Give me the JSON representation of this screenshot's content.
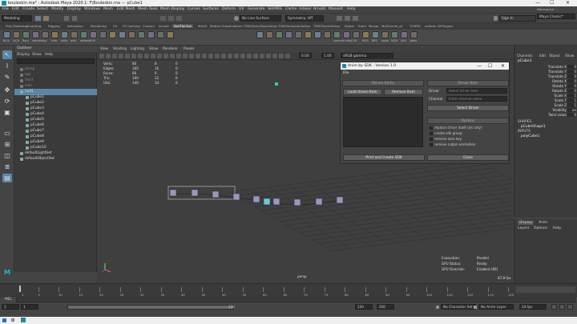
{
  "window": {
    "title": "bouleskin.ma* - Autodesk Maya 2020.1: F\\Bouleskin.ma  ---  pCube1",
    "min": "—",
    "max": "☐",
    "close": "✕"
  },
  "menubar": [
    "File",
    "Edit",
    "Create",
    "Select",
    "Modify",
    "Display",
    "Windows",
    "Mesh",
    "Edit Mesh",
    "Mesh Tools",
    "Mesh Display",
    "Curves",
    "Surfaces",
    "Deform",
    "UV",
    "Generate",
    "SHAPES",
    "Cache",
    "mGear",
    "Arnold",
    "MooseX",
    "Help"
  ],
  "statusline": {
    "mode": "Modeling",
    "live": "No Live Surface",
    "symmetry": "Symmetry: Off",
    "signin": "Sign In",
    "workspace_label": "Workspace :",
    "workspace": "Maya Classic*"
  },
  "shelf_tabs": [
    "Poly Modeling",
    "Sculpting",
    "Rigging",
    "Animation",
    "Rendering",
    "FX",
    "FX Caching",
    "Custom",
    "Arnold",
    "BatRTarTool",
    "MASH",
    "Motion Graphics",
    "XGen",
    "TSM2ExtraToolsSetup",
    "TSM2SelectionSetup",
    "TSM2FacialSetup",
    "Mgear",
    "Extra",
    "Mocap",
    "MuFtsirvie_vil",
    "TORTIE",
    "calbres",
    "GEPluginz"
  ],
  "shelf_labels": [
    "BrCh",
    "LtCh",
    "RsLn",
    "rebuild",
    "dup",
    "hide",
    "jntify",
    "wfrk",
    "rgReset",
    "CrM",
    "",
    "",
    "",
    "",
    "",
    "",
    "",
    "",
    "",
    "",
    "",
    "",
    "",
    "",
    "",
    "",
    "Lemma",
    "CrrMaj",
    "CM",
    "MCR",
    "BRS",
    "dublk",
    "MCM",
    "ARO",
    "bake"
  ],
  "outliner": {
    "title": "Outliner",
    "menu": [
      "Display",
      "Show",
      "Help"
    ],
    "items": [
      "persp",
      "top",
      "front",
      "side",
      "null1",
      "pCube1",
      "pCube2",
      "pCube3",
      "pCube4",
      "pCube5",
      "pCube6",
      "pCube7",
      "pCube8",
      "pCube9",
      "pCube10",
      "defaultLightSet",
      "defaultObjectSet"
    ]
  },
  "viewport": {
    "menu": [
      "View",
      "Shading",
      "Lighting",
      "Show",
      "Renderer",
      "Panels"
    ],
    "hud_rows": [
      [
        "Verts:",
        "80",
        "8",
        "0"
      ],
      [
        "Edges:",
        "160",
        "16",
        "0"
      ],
      [
        "Faces:",
        "80",
        "6",
        "0"
      ],
      [
        "Tris:",
        "160",
        "12",
        "0"
      ],
      [
        "UVs:",
        "140",
        "14",
        "0"
      ]
    ],
    "exposure": "0.00",
    "gamma": "1.00",
    "color_space": "sRGB gamma",
    "camera": "persp",
    "evaluation": [
      [
        "Evaluation:",
        "Parallel"
      ],
      [
        "GPU Status:",
        "Ready"
      ],
      [
        "GPU Override:",
        "Enabled (96)"
      ]
    ],
    "fps": "87.8 fps"
  },
  "dialog": {
    "title": "Anim by SDK - Version 1.0",
    "min": "—",
    "max": "☐",
    "close": "✕",
    "menu": "File",
    "driven_header": "Driven Items",
    "load_driven": "Load driven Item",
    "remove_item": "Remove Item",
    "driver_header": "Driver Item",
    "driver_label": "Driver",
    "driver_placeholder": "Select driver item",
    "channel_label": "Channel",
    "channel_placeholder": "Enter channel name",
    "select_driver": "Select Driver",
    "options_header": "Options",
    "options": [
      "replace driver itself (jnt only)",
      "create sdk group",
      "remove zero key",
      "remove cutpin animation"
    ],
    "create_btn": "Print and Create SDK",
    "close_btn": "Close"
  },
  "attribute_editor": {
    "tabs": [
      "Channels",
      "Edit",
      "Object",
      "Show"
    ],
    "object": "pCube1",
    "rows": [
      [
        "Translate X",
        "0"
      ],
      [
        "Translate Y",
        "0"
      ],
      [
        "Translate Z",
        "0"
      ],
      [
        "Rotate X",
        "0"
      ],
      [
        "Rotate Y",
        "0"
      ],
      [
        "Rotate Z",
        "0"
      ],
      [
        "Scale X",
        "1"
      ],
      [
        "Scale Y",
        "1"
      ],
      [
        "Scale Z",
        "1"
      ],
      [
        "Visibility",
        "on"
      ],
      [
        "Twist value",
        "0"
      ]
    ],
    "shapes_header": "SHAPES",
    "shape": "pCubeShape1",
    "inputs_header": "INPUTS",
    "input": "polyCube1"
  },
  "layer_editor": {
    "tabs": [
      "Display",
      "Anim"
    ],
    "menu": [
      "Layers",
      "Options",
      "Help"
    ]
  },
  "timeslider": {
    "ticks": [
      "5",
      "10",
      "15",
      "20",
      "25",
      "30",
      "35",
      "40",
      "45",
      "50",
      "55",
      "60",
      "65",
      "70",
      "75",
      "80",
      "85",
      "90",
      "95",
      "100",
      "105",
      "110",
      "115",
      "120"
    ],
    "current": "1"
  },
  "mel": "MEL",
  "range": {
    "start": "1",
    "start2": "1",
    "end": "120",
    "end2": "120",
    "max": "200",
    "character_set": "No Character Set",
    "anim_layer": "No Anim Layer",
    "fps": "24 fps"
  }
}
